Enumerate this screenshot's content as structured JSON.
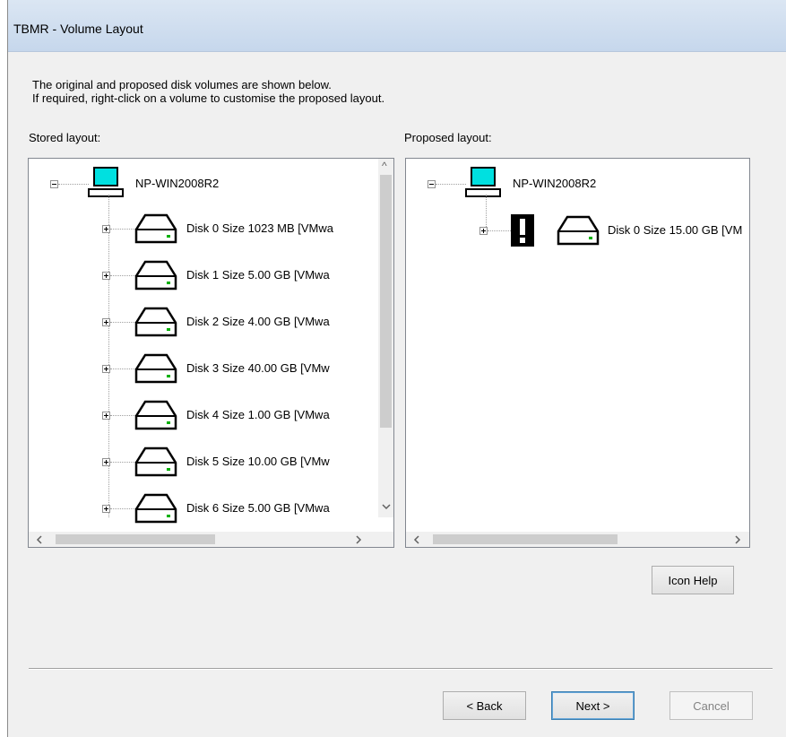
{
  "window": {
    "title": "TBMR - Volume Layout"
  },
  "intro": {
    "line1": "The original and proposed disk volumes are shown below.",
    "line2": "If required, right-click on a volume to customise the proposed layout."
  },
  "stored": {
    "label": "Stored layout:",
    "root": "NP-WIN2008R2",
    "disks": [
      "Disk 0 Size 1023 MB [VMwa",
      "Disk 1 Size  5.00 GB [VMwa",
      "Disk 2 Size  4.00 GB [VMwa",
      "Disk 3 Size 40.00 GB [VMw",
      "Disk 4 Size  1.00 GB [VMwa",
      "Disk 5 Size 10.00 GB [VMw",
      "Disk 6 Size  5.00 GB [VMwa"
    ]
  },
  "proposed": {
    "label": "Proposed layout:",
    "root": "NP-WIN2008R2",
    "disks": [
      "Disk 0 Size 15.00 GB [VM"
    ]
  },
  "buttons": {
    "icon_help": "Icon Help",
    "back": "< Back",
    "next": "Next >",
    "cancel": "Cancel"
  },
  "colors": {
    "monitor_screen": "#00e0e0",
    "disk_led": "#00b000",
    "default_button_border": "#3c7fb1"
  }
}
